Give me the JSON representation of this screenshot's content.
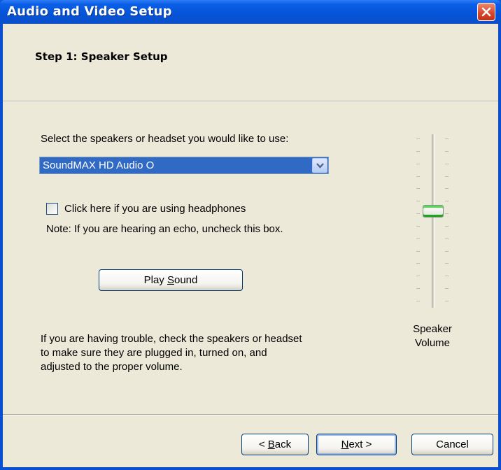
{
  "window": {
    "title": "Audio and Video Setup",
    "close_icon": "close-icon"
  },
  "header": {
    "step_title": "Step 1: Speaker Setup"
  },
  "device": {
    "prompt": "Select the speakers or headset you would like to use:",
    "selected": "SoundMAX HD Audio O"
  },
  "headphones": {
    "checkbox_label": "Click here if you are using headphones",
    "checked": false,
    "note": "Note: If you are hearing an echo, uncheck this box."
  },
  "play_sound": {
    "label_pre": "Play ",
    "label_key": "S",
    "label_post": "ound"
  },
  "trouble_text": {
    "line1": "If you are having trouble, check the speakers or headset",
    "line2": "to make sure they are plugged in, turned on, and",
    "line3": "adjusted to the proper volume."
  },
  "volume": {
    "label_line1": "Speaker",
    "label_line2": "Volume",
    "level_fraction": 0.55
  },
  "footer": {
    "back": {
      "pre": "< ",
      "key": "B",
      "post": "ack"
    },
    "next": {
      "key": "N",
      "post": "ext >"
    },
    "cancel": "Cancel"
  },
  "colors": {
    "titlebar": "#0553d8",
    "dialog_bg": "#ece9d8",
    "selection": "#316ac5"
  }
}
